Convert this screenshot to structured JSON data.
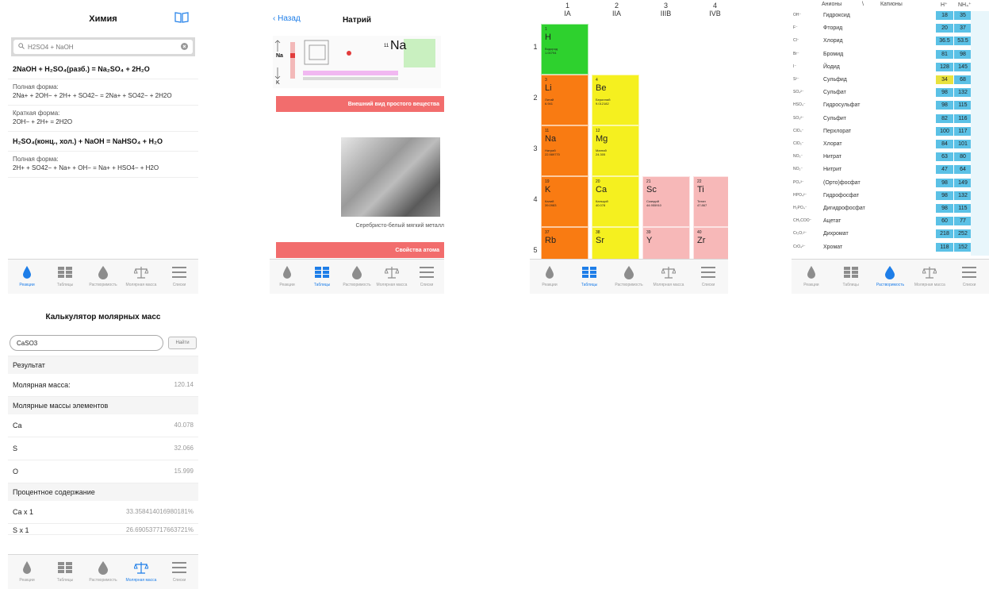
{
  "screen1": {
    "title": "Химия",
    "search_value": "H2SO4 + NaOH",
    "reactions": [
      {
        "equation": "2NaOH + H₂SO₄(разб.) = Na₂SO₄ + 2H₂O",
        "full_label": "Полная форма:",
        "full": "2Na+ + 2OH− + 2H+ + SO42− = 2Na+ + SO42− + 2H2O",
        "short_label": "Краткая форма:",
        "short": "2OH− + 2H+ = 2H2O"
      },
      {
        "equation": "H₂SO₄(конц., хол.) + NaOH = NaHSO₄ + H₂O",
        "full_label": "Полная форма:",
        "full": "2H+ + SO42− + Na+ + OH− = Na+ + HSO4− + H2O"
      }
    ]
  },
  "screen2": {
    "back": "Назад",
    "title": "Натрий",
    "mini_symbol": "Na",
    "mini_number": "11",
    "mini_period": "Na",
    "mini_k": "K",
    "section1": "Внешний вид простого вещества",
    "caption": "Серебристо-белый мягкий металл",
    "section2": "Свойства атома"
  },
  "screen3": {
    "groups": [
      {
        "num": "1",
        "name": "IA"
      },
      {
        "num": "2",
        "name": "IIA"
      },
      {
        "num": "3",
        "name": "IIIB"
      },
      {
        "num": "4",
        "name": "IVB"
      }
    ],
    "periods": [
      "1",
      "2",
      "3",
      "4",
      "5"
    ],
    "elements": [
      {
        "n": "1",
        "s": "H",
        "nm": "Водород",
        "m": "1.00794",
        "col": 0,
        "row": 0,
        "color": "#2ed12e"
      },
      {
        "n": "3",
        "s": "Li",
        "nm": "Литий",
        "m": "6.941",
        "col": 0,
        "row": 1,
        "color": "#f97b12"
      },
      {
        "n": "4",
        "s": "Be",
        "nm": "Бериллий",
        "m": "9.012182",
        "col": 1,
        "row": 1,
        "color": "#f5f01f"
      },
      {
        "n": "11",
        "s": "Na",
        "nm": "Натрий",
        "m": "22.989770",
        "col": 0,
        "row": 2,
        "color": "#f97b12"
      },
      {
        "n": "12",
        "s": "Mg",
        "nm": "Магний",
        "m": "24.305",
        "col": 1,
        "row": 2,
        "color": "#f5f01f"
      },
      {
        "n": "19",
        "s": "K",
        "nm": "Калий",
        "m": "39.0983",
        "col": 0,
        "row": 3,
        "color": "#f97b12"
      },
      {
        "n": "20",
        "s": "Ca",
        "nm": "Кальций",
        "m": "40.078",
        "col": 1,
        "row": 3,
        "color": "#f5f01f"
      },
      {
        "n": "21",
        "s": "Sc",
        "nm": "Скандий",
        "m": "44.955910",
        "col": 2,
        "row": 3,
        "color": "#f7b8b8"
      },
      {
        "n": "22",
        "s": "Ti",
        "nm": "Титан",
        "m": "47.867",
        "col": 3,
        "row": 3,
        "color": "#f7b8b8"
      },
      {
        "n": "37",
        "s": "Rb",
        "nm": "",
        "m": "",
        "col": 0,
        "row": 4,
        "color": "#f97b12"
      },
      {
        "n": "38",
        "s": "Sr",
        "nm": "",
        "m": "",
        "col": 1,
        "row": 4,
        "color": "#f5f01f"
      },
      {
        "n": "39",
        "s": "Y",
        "nm": "",
        "m": "",
        "col": 2,
        "row": 4,
        "color": "#f7b8b8"
      },
      {
        "n": "40",
        "s": "Zr",
        "nm": "",
        "m": "",
        "col": 3,
        "row": 4,
        "color": "#f7b8b8"
      }
    ]
  },
  "screen4": {
    "head_anions": "Анионы",
    "head_sep": "\\",
    "head_cations": "Катионы",
    "col1": "H⁺",
    "col2": "NH₄⁺",
    "rows": [
      {
        "f": "OH⁻",
        "n": "Гидроксид",
        "a": "18",
        "b": "35"
      },
      {
        "f": "F⁻",
        "n": "Фторид",
        "a": "20",
        "b": "37"
      },
      {
        "f": "Cl⁻",
        "n": "Хлорид",
        "a": "36.5",
        "b": "53.5"
      },
      {
        "f": "Br⁻",
        "n": "Бромид",
        "a": "81",
        "b": "98"
      },
      {
        "f": "I⁻",
        "n": "Йодид",
        "a": "128",
        "b": "145"
      },
      {
        "f": "S²⁻",
        "n": "Сульфид",
        "a": "34",
        "b": "68",
        "hl": true
      },
      {
        "f": "SO₄²⁻",
        "n": "Сульфат",
        "a": "98",
        "b": "132"
      },
      {
        "f": "HSO₄⁻",
        "n": "Гидросульфат",
        "a": "98",
        "b": "115"
      },
      {
        "f": "SO₃²⁻",
        "n": "Сульфит",
        "a": "82",
        "b": "116"
      },
      {
        "f": "ClO₄⁻",
        "n": "Перхлорат",
        "a": "100",
        "b": "117"
      },
      {
        "f": "ClO₃⁻",
        "n": "Хлорат",
        "a": "84",
        "b": "101"
      },
      {
        "f": "NO₃⁻",
        "n": "Нитрат",
        "a": "63",
        "b": "80"
      },
      {
        "f": "NO₂⁻",
        "n": "Нитрит",
        "a": "47",
        "b": "64"
      },
      {
        "f": "PO₄³⁻",
        "n": "(Орто)фосфат",
        "a": "98",
        "b": "149"
      },
      {
        "f": "HPO₄²⁻",
        "n": "Гидрофосфат",
        "a": "98",
        "b": "132"
      },
      {
        "f": "H₂PO₄⁻",
        "n": "Дигидрофосфат",
        "a": "98",
        "b": "115"
      },
      {
        "f": "CH₃COO⁻",
        "n": "Ацетат",
        "a": "60",
        "b": "77"
      },
      {
        "f": "Cr₂O₇²⁻",
        "n": "Дихромат",
        "a": "218",
        "b": "252"
      },
      {
        "f": "CrO₄²⁻",
        "n": "Хромат",
        "a": "118",
        "b": "152"
      }
    ]
  },
  "screen5": {
    "title": "Калькулятор молярных масс",
    "input_value": "CaSO3",
    "find_button": "Найти",
    "result_header": "Результат",
    "molar_label": "Молярная масса:",
    "molar_value": "120.14",
    "elements_header": "Молярные массы элементов",
    "elements": [
      {
        "name": "Ca",
        "value": "40.078"
      },
      {
        "name": "S",
        "value": "32.066"
      },
      {
        "name": "O",
        "value": "15.999"
      }
    ],
    "percent_header": "Процентное содержание",
    "percent": [
      {
        "name": "Ca x 1",
        "value": "33.358414016980181%"
      },
      {
        "name": "S x 1",
        "value": "26.690537717663721%"
      }
    ]
  },
  "tabs": [
    "Реакции",
    "Таблицы",
    "Растворимость",
    "Молярная масса",
    "Списки"
  ],
  "tabbars": [
    {
      "screen": "screen1",
      "active": 0
    },
    {
      "screen": "screen2",
      "active": 1
    },
    {
      "screen": "screen3",
      "active": 1
    },
    {
      "screen": "screen4",
      "active": 2
    },
    {
      "screen": "screen5",
      "active": 3
    }
  ],
  "colors": {
    "accent": "#1e7ee8",
    "alkali": "#f97b12",
    "alkaline_earth": "#f5f01f",
    "hydrogen": "#2ed12e",
    "transition": "#f7b8b8",
    "solubility": "#5bc1e6",
    "highlight": "#e8e23e",
    "section_bar": "#f26d6d"
  }
}
